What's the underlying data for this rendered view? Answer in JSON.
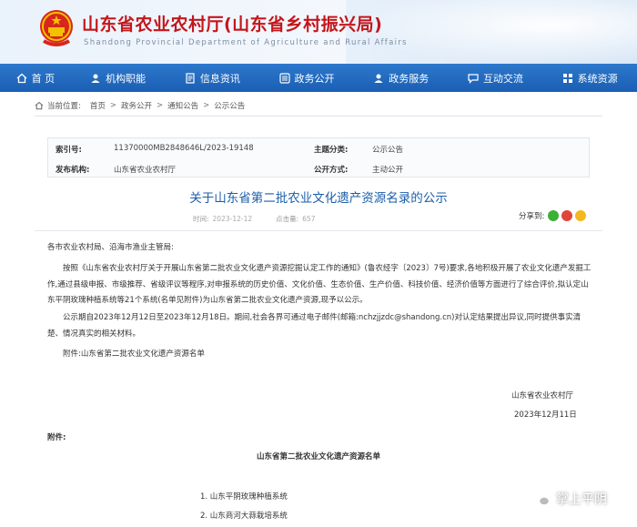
{
  "header": {
    "title": "山东省农业农村厅(山东省乡村振兴局)",
    "subtitle": "Shandong Provincial Department of Agriculture and Rural Affairs"
  },
  "nav": [
    {
      "label": "首 页",
      "icon": "home-icon"
    },
    {
      "label": "机构职能",
      "icon": "user-icon"
    },
    {
      "label": "信息资讯",
      "icon": "document-icon"
    },
    {
      "label": "政务公开",
      "icon": "list-icon"
    },
    {
      "label": "政务服务",
      "icon": "user-icon"
    },
    {
      "label": "互动交流",
      "icon": "chat-icon"
    },
    {
      "label": "系统资源",
      "icon": "grid-icon"
    }
  ],
  "breadcrumb": {
    "prefix": "当前位置:",
    "items": [
      "首页",
      "政务公开",
      "通知公告",
      "公示公告"
    ]
  },
  "meta": {
    "index_label": "索引号:",
    "index_value": "11370000MB2848646L/2023-19148",
    "topic_label": "主题分类:",
    "topic_value": "公示公告",
    "issuer_label": "发布机构:",
    "issuer_value": "山东省农业农村厅",
    "mode_label": "公开方式:",
    "mode_value": "主动公开"
  },
  "article": {
    "title": "关于山东省第二批农业文化遗产资源名录的公示",
    "time_label": "时间:",
    "time_value": "2023-12-12",
    "views_label": "点击量:",
    "views_value": "657",
    "share_label": "分享到:",
    "greeting": "各市农业农村局、沿海市渔业主管局:",
    "para1": "按照《山东省农业农村厅关于开展山东省第二批农业文化遗产资源挖掘认定工作的通知》(鲁农经字〔2023〕7号)要求,各地积极开展了农业文化遗产发掘工作,通过县级申报、市级推荐、省级评议等程序,对申报系统的历史价值、文化价值、生态价值、生产价值、科技价值、经济价值等方面进行了综合评价,拟认定山东平阴玫瑰种植系统等21个系统(名单见附件)为山东省第二批农业文化遗产资源,现予以公示。",
    "para2": "公示期自2023年12月12日至2023年12月18日。期间,社会各界可通过电子邮件(邮箱:nchzjjzdc@shandong.cn)对认定结果提出异议,同时提供事实清楚、情况真实的相关材料。",
    "attachment": "附件:山东省第二批农业文化遗产资源名单",
    "sign_org": "山东省农业农村厅",
    "sign_date": "2023年12月11日",
    "attach_head": "附件:",
    "list_title": "山东省第二批农业文化遗产资源名单",
    "list": [
      "1.  山东平阴玫瑰种植系统",
      "2.  山东商河大蒜栽培系统"
    ]
  },
  "watermark": "掌上平阴",
  "colors": {
    "nav_bg": "#1a5fb4",
    "title_red": "#c3161c",
    "article_title": "#1b5ea9"
  }
}
